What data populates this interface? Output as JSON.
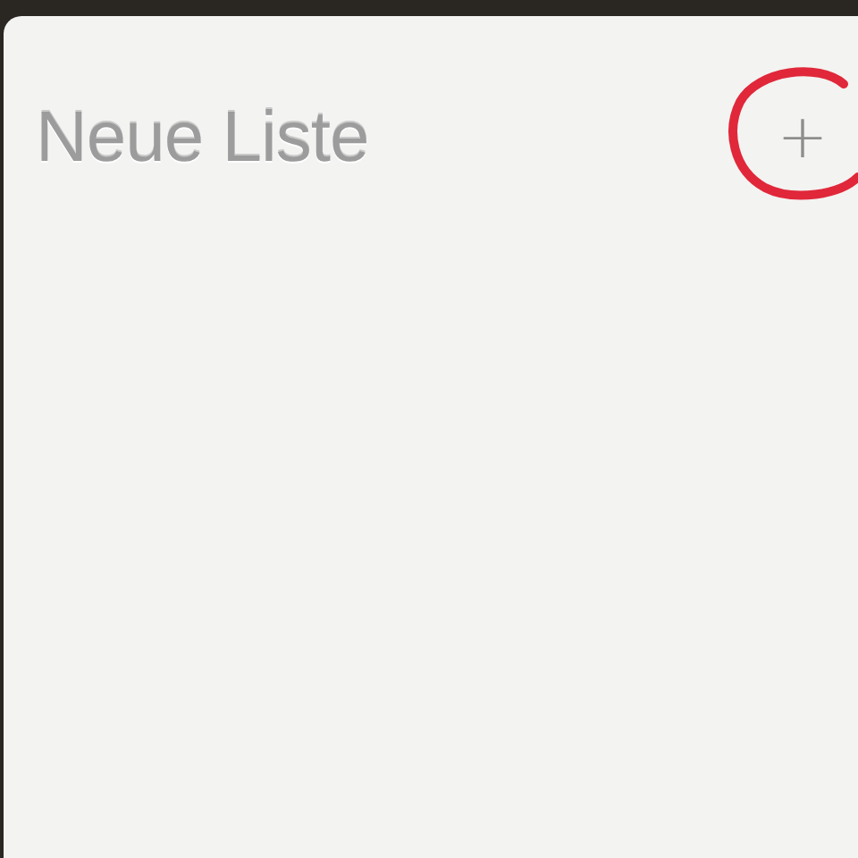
{
  "list": {
    "title": "Neue Liste",
    "add_button": "+"
  }
}
